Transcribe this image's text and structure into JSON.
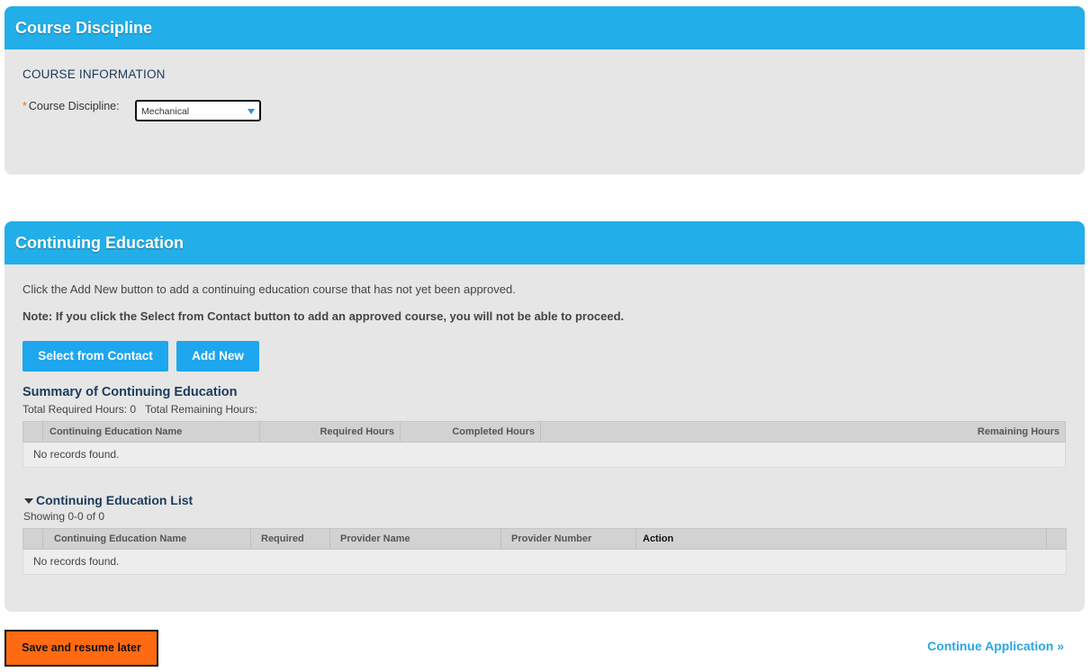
{
  "course_panel": {
    "title": "Course Discipline",
    "section_title": "COURSE INFORMATION",
    "required_marker": "*",
    "field_label": "Course Discipline:",
    "selected_value": "Mechanical"
  },
  "ce_panel": {
    "title": "Continuing Education",
    "instruction": "Click the Add New button to add a continuing education course that has not yet been approved.",
    "note": "Note: If you click the Select from Contact button to add an approved course, you will not be able to proceed.",
    "select_button": "Select from Contact",
    "add_button": "Add New",
    "summary": {
      "title": "Summary of Continuing Education",
      "total_required": "Total Required Hours: 0",
      "total_remaining": "Total Remaining Hours:",
      "columns": [
        "Continuing Education Name",
        "Required Hours",
        "Completed Hours",
        "Remaining Hours"
      ],
      "empty_text": "No records found."
    },
    "list": {
      "title": "Continuing Education List",
      "showing": "Showing 0-0 of 0",
      "columns": [
        "Continuing Education Name",
        "Required",
        "Provider Name",
        "Provider Number",
        "Action"
      ],
      "empty_text": "No records found."
    }
  },
  "footer": {
    "save_button": "Save and resume later",
    "continue_link": "Continue Application »"
  },
  "colors": {
    "header_blue": "#22aee8",
    "button_blue": "#1ea6ee",
    "save_orange": "#ff6a13",
    "link_blue": "#2aa7e0"
  }
}
